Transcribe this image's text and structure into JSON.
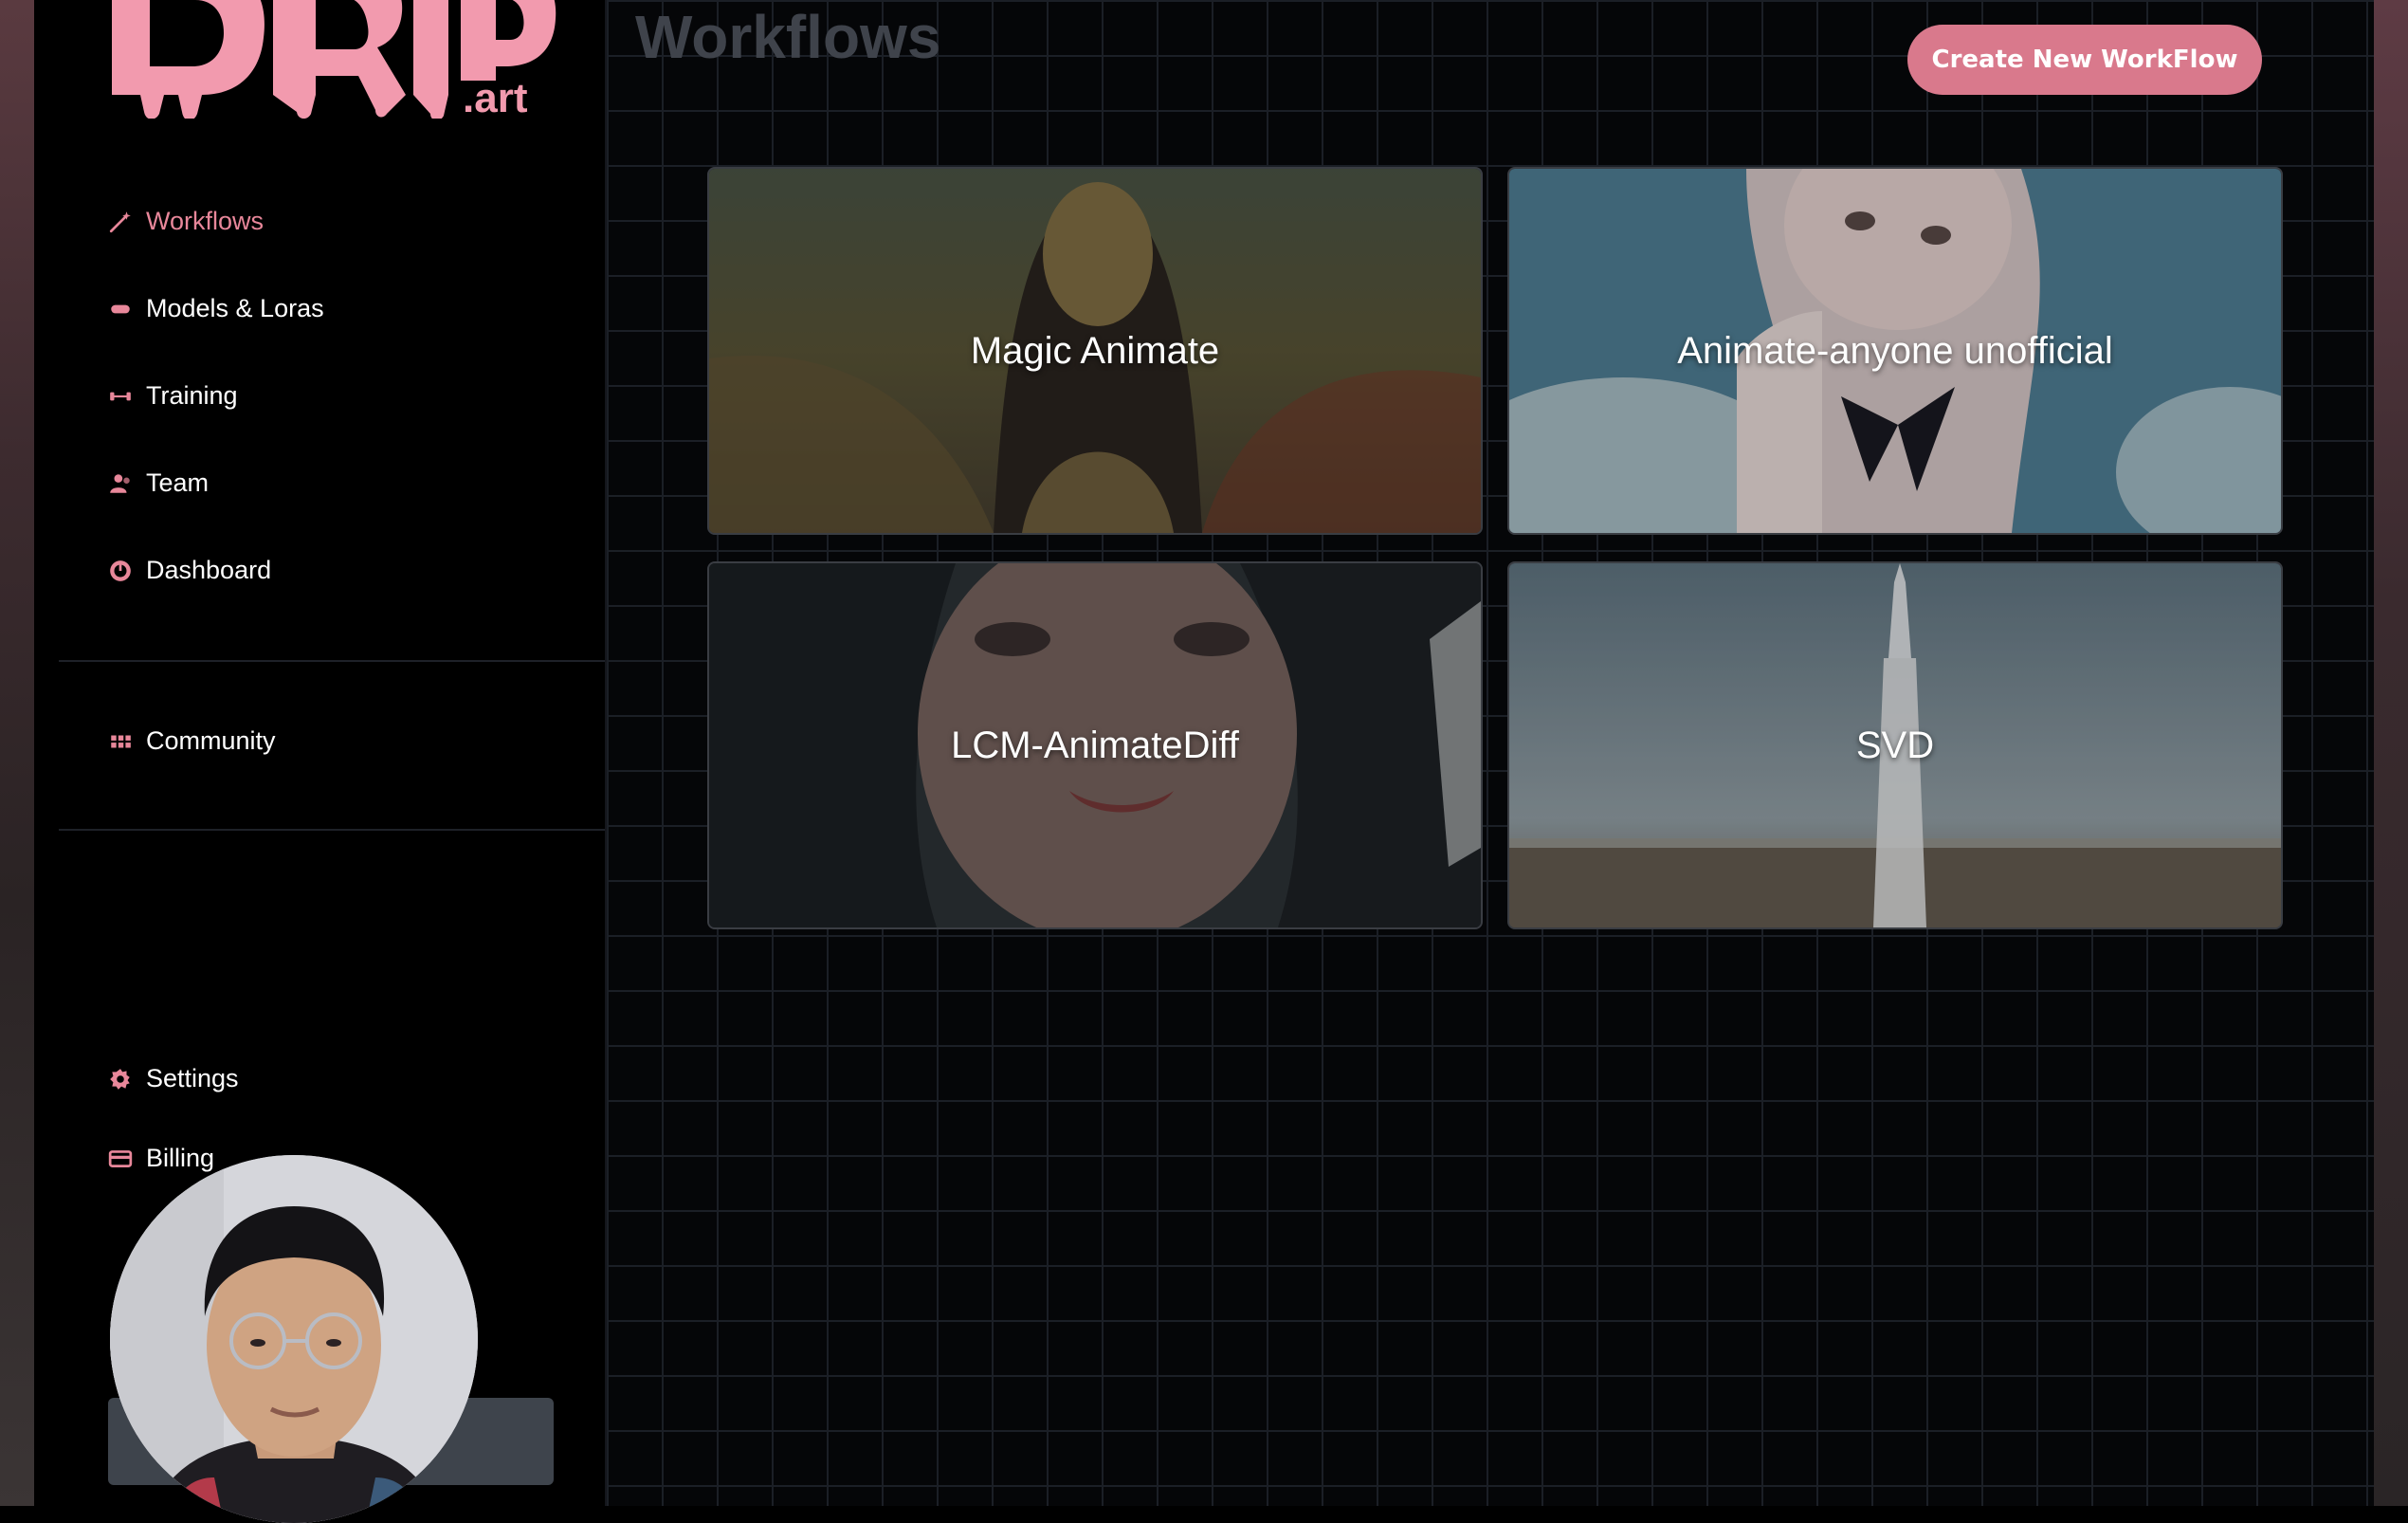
{
  "app": {
    "logo_text": "DRIP.art",
    "colors": {
      "accent": "#d9798c",
      "active_nav": "#e8879a",
      "title": "#3f434b"
    }
  },
  "sidebar": {
    "items": [
      {
        "label": "Workflows",
        "icon": "wand-icon",
        "active": true
      },
      {
        "label": "Models & Loras",
        "icon": "pill-icon",
        "active": false
      },
      {
        "label": "Training",
        "icon": "dumbbell-icon",
        "active": false
      },
      {
        "label": "Team",
        "icon": "team-icon",
        "active": false
      },
      {
        "label": "Dashboard",
        "icon": "gauge-icon",
        "active": false
      }
    ],
    "community": {
      "label": "Community",
      "icon": "grid-icon"
    },
    "bottom": [
      {
        "label": "Settings",
        "icon": "gear-icon"
      },
      {
        "label": "Billing",
        "icon": "credit-card-icon"
      }
    ]
  },
  "header": {
    "title": "Workflows",
    "create_button": "Create New WorkFlow"
  },
  "workflows": [
    {
      "title": "Magic Animate"
    },
    {
      "title": "Animate-anyone unofficial"
    },
    {
      "title": "LCM-AnimateDiff"
    },
    {
      "title": "SVD"
    }
  ]
}
